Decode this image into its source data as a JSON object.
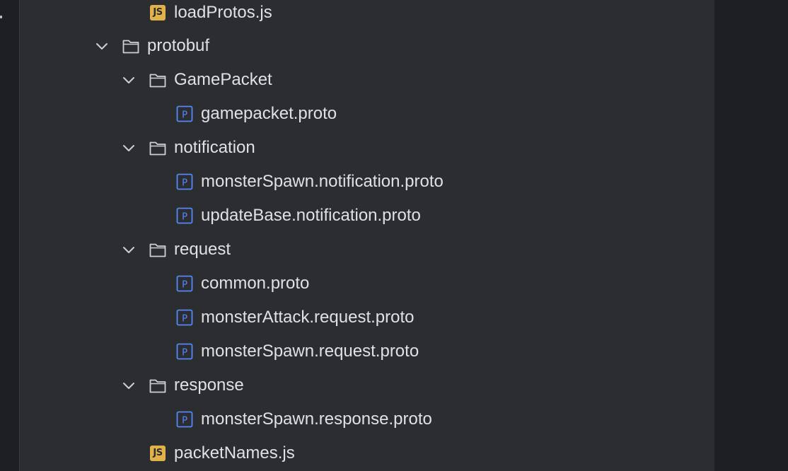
{
  "tree": {
    "items": [
      {
        "label": "loadProtos.js",
        "kind": "js-file",
        "icon": "js-file-icon"
      },
      {
        "label": "protobuf",
        "kind": "folder",
        "expanded": true,
        "icon": "folder-icon"
      },
      {
        "label": "GamePacket",
        "kind": "folder",
        "expanded": true,
        "icon": "folder-icon"
      },
      {
        "label": "gamepacket.proto",
        "kind": "proto-file",
        "icon": "proto-file-icon"
      },
      {
        "label": "notification",
        "kind": "folder",
        "expanded": true,
        "icon": "folder-icon"
      },
      {
        "label": "monsterSpawn.notification.proto",
        "kind": "proto-file",
        "icon": "proto-file-icon"
      },
      {
        "label": "updateBase.notification.proto",
        "kind": "proto-file",
        "icon": "proto-file-icon"
      },
      {
        "label": "request",
        "kind": "folder",
        "expanded": true,
        "icon": "folder-icon"
      },
      {
        "label": "common.proto",
        "kind": "proto-file",
        "icon": "proto-file-icon"
      },
      {
        "label": "monsterAttack.request.proto",
        "kind": "proto-file",
        "icon": "proto-file-icon"
      },
      {
        "label": "monsterSpawn.request.proto",
        "kind": "proto-file",
        "icon": "proto-file-icon"
      },
      {
        "label": "response",
        "kind": "folder",
        "expanded": true,
        "icon": "folder-icon"
      },
      {
        "label": "monsterSpawn.response.proto",
        "kind": "proto-file",
        "icon": "proto-file-icon"
      },
      {
        "label": "packetNames.js",
        "kind": "js-file",
        "icon": "js-file-icon"
      }
    ],
    "js_badge_text": "JS",
    "proto_badge_text": "P"
  },
  "colors": {
    "panel_bg": "#2b2d30",
    "outer_bg": "#1e1f22",
    "text": "#dfe1e5",
    "proto_blue": "#548af7",
    "js_yellow": "#e2b24a",
    "icon_grey": "#ced0d6"
  }
}
